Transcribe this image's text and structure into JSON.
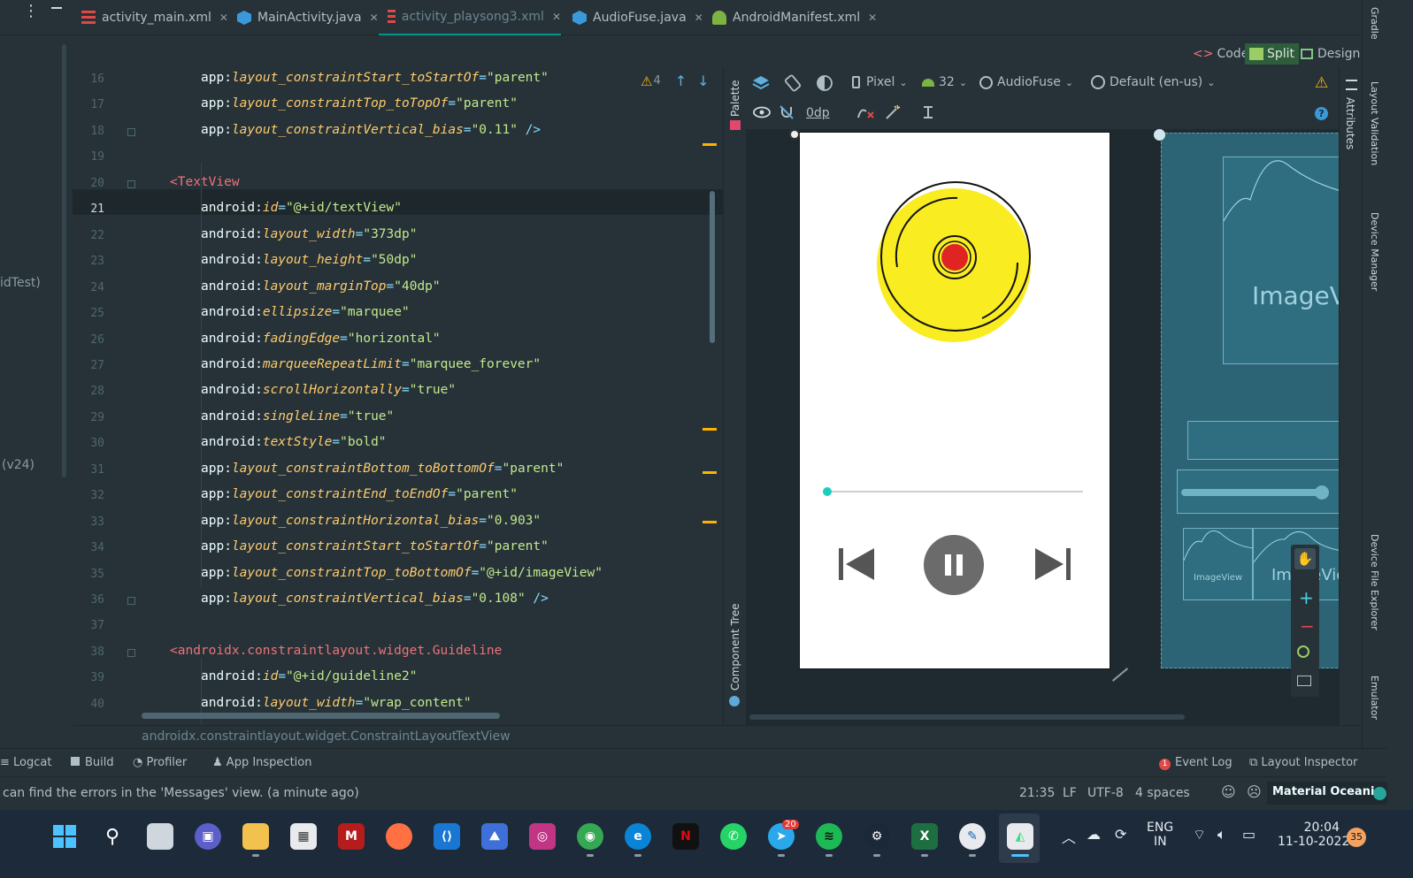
{
  "tabs": [
    {
      "label": "activity_main.xml",
      "icon": "xml-file-icon"
    },
    {
      "label": "MainActivity.java",
      "icon": "java-class-icon"
    },
    {
      "label": "activity_playsong3.xml",
      "icon": "xml-file-icon",
      "active": true
    },
    {
      "label": "AudioFuse.java",
      "icon": "java-class-icon"
    },
    {
      "label": "AndroidManifest.xml",
      "icon": "android-icon"
    }
  ],
  "view_modes": {
    "code": "Code",
    "split": "Split",
    "design": "Design",
    "selected": "Split"
  },
  "left_panel": {
    "frag1": "idTest)",
    "frag2": "(v24)"
  },
  "editor": {
    "warning_count": "4",
    "lines": [
      {
        "n": "16",
        "prefix": "app",
        "attr": "layout_constraintStart_toStartOf",
        "value": "\"parent\""
      },
      {
        "n": "17",
        "prefix": "app",
        "attr": "layout_constraintTop_toTopOf",
        "value": "\"parent\""
      },
      {
        "n": "18",
        "prefix": "app",
        "attr": "layout_constraintVertical_bias",
        "value": "\"0.11\"",
        "close": " />"
      },
      {
        "n": "19"
      },
      {
        "n": "20",
        "tag": "<TextView"
      },
      {
        "n": "21",
        "prefix": "android",
        "attr": "id",
        "value": "\"@+id/textView\""
      },
      {
        "n": "22",
        "prefix": "android",
        "attr": "layout_width",
        "value": "\"373dp\""
      },
      {
        "n": "23",
        "prefix": "android",
        "attr": "layout_height",
        "value": "\"50dp\""
      },
      {
        "n": "24",
        "prefix": "android",
        "attr": "layout_marginTop",
        "value": "\"40dp\""
      },
      {
        "n": "25",
        "prefix": "android",
        "attr": "ellipsize",
        "value": "\"marquee\""
      },
      {
        "n": "26",
        "prefix": "android",
        "attr": "fadingEdge",
        "value": "\"horizontal\""
      },
      {
        "n": "27",
        "prefix": "android",
        "attr": "marqueeRepeatLimit",
        "value": "\"marquee_forever\""
      },
      {
        "n": "28",
        "prefix": "android",
        "attr": "scrollHorizontally",
        "value": "\"true\""
      },
      {
        "n": "29",
        "prefix": "android",
        "attr": "singleLine",
        "value": "\"true\""
      },
      {
        "n": "30",
        "prefix": "android",
        "attr": "textStyle",
        "value": "\"bold\""
      },
      {
        "n": "31",
        "prefix": "app",
        "attr": "layout_constraintBottom_toBottomOf",
        "value": "\"parent\""
      },
      {
        "n": "32",
        "prefix": "app",
        "attr": "layout_constraintEnd_toEndOf",
        "value": "\"parent\""
      },
      {
        "n": "33",
        "prefix": "app",
        "attr": "layout_constraintHorizontal_bias",
        "value": "\"0.903\""
      },
      {
        "n": "34",
        "prefix": "app",
        "attr": "layout_constraintStart_toStartOf",
        "value": "\"parent\""
      },
      {
        "n": "35",
        "prefix": "app",
        "attr": "layout_constraintTop_toBottomOf",
        "value": "\"@+id/imageView\""
      },
      {
        "n": "36",
        "prefix": "app",
        "attr": "layout_constraintVertical_bias",
        "value": "\"0.108\"",
        "close": " />"
      },
      {
        "n": "37"
      },
      {
        "n": "38",
        "tag": "<androidx.constraintlayout.widget.Guideline"
      },
      {
        "n": "39",
        "prefix": "android",
        "attr": "id",
        "value": "\"@+id/guideline2\""
      },
      {
        "n": "40",
        "prefix": "android",
        "attr": "layout_width",
        "value": "\"wrap_content\""
      }
    ]
  },
  "side_panels": {
    "palette": "Palette",
    "component_tree": "Component Tree",
    "attributes": "Attributes"
  },
  "design_toolbar": {
    "device": "Pixel",
    "api": "32",
    "theme": "AudioFuse",
    "locale": "Default (en-us)",
    "margin": "0dp"
  },
  "blueprint": {
    "image_view_large": "ImageV",
    "image_view_small": "ImageView",
    "image_view_medium": "ImageVie"
  },
  "player": {
    "seek_progress": 0.0
  },
  "right_rail": [
    "Gradle",
    "Layout Validation",
    "Device Manager",
    "Device File Explorer",
    "Emulator"
  ],
  "breadcrumb": [
    "androidx.constraintlayout.widget.ConstraintLayout",
    "TextView"
  ],
  "tool_windows": {
    "logcat": "Logcat",
    "build": "Build",
    "profiler": "Profiler",
    "app_inspection": "App Inspection",
    "event_log": "Event Log",
    "layout_inspector": "Layout Inspector"
  },
  "status": {
    "message": "can find the errors in the 'Messages' view. (a minute ago)",
    "position": "21:35",
    "line_sep": "LF",
    "encoding": "UTF-8",
    "indent": "4 spaces",
    "theme": "Material Oceanic"
  },
  "taskbar": {
    "lang1": "ENG",
    "lang2": "IN",
    "time": "20:04",
    "date": "11-10-2022",
    "notif_count": "35",
    "telegram_badge": "20"
  },
  "colors": {
    "accent": "#009688",
    "editor_bg": "#263238",
    "disc_yellow": "#f9ec21",
    "disc_red": "#e02424",
    "seek_thumb": "#1ccdc0"
  }
}
